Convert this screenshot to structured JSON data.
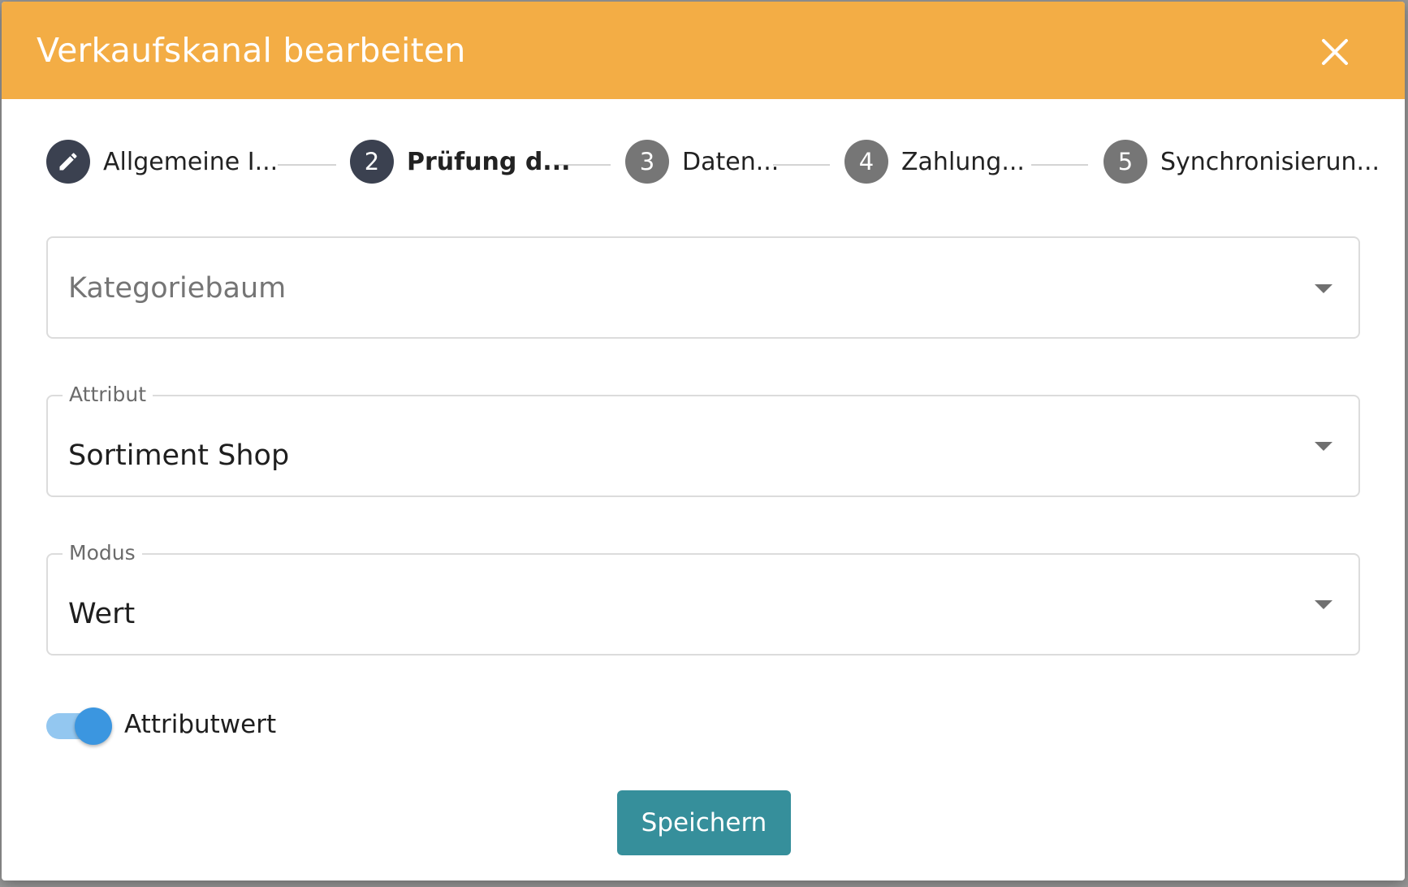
{
  "dialog": {
    "title": "Verkaufskanal bearbeiten",
    "header_color": "#f3ad45"
  },
  "stepper": {
    "steps": [
      {
        "number": "",
        "label": "Allgemeine I...",
        "state": "edit",
        "icon": "pencil-icon"
      },
      {
        "number": "2",
        "label": "Prüfung d...",
        "state": "active"
      },
      {
        "number": "3",
        "label": "Daten...",
        "state": "inactive"
      },
      {
        "number": "4",
        "label": "Zahlung...",
        "state": "inactive"
      },
      {
        "number": "5",
        "label": "Synchronisierun...",
        "state": "inactive"
      }
    ]
  },
  "form": {
    "kategoriebaum": {
      "placeholder": "Kategoriebaum",
      "value": ""
    },
    "attribut": {
      "label": "Attribut",
      "value": "Sortiment Shop"
    },
    "modus": {
      "label": "Modus",
      "value": "Wert"
    },
    "attributwert_toggle": {
      "label": "Attributwert",
      "checked": true
    }
  },
  "actions": {
    "save_label": "Speichern",
    "save_color": "#368f9b"
  }
}
